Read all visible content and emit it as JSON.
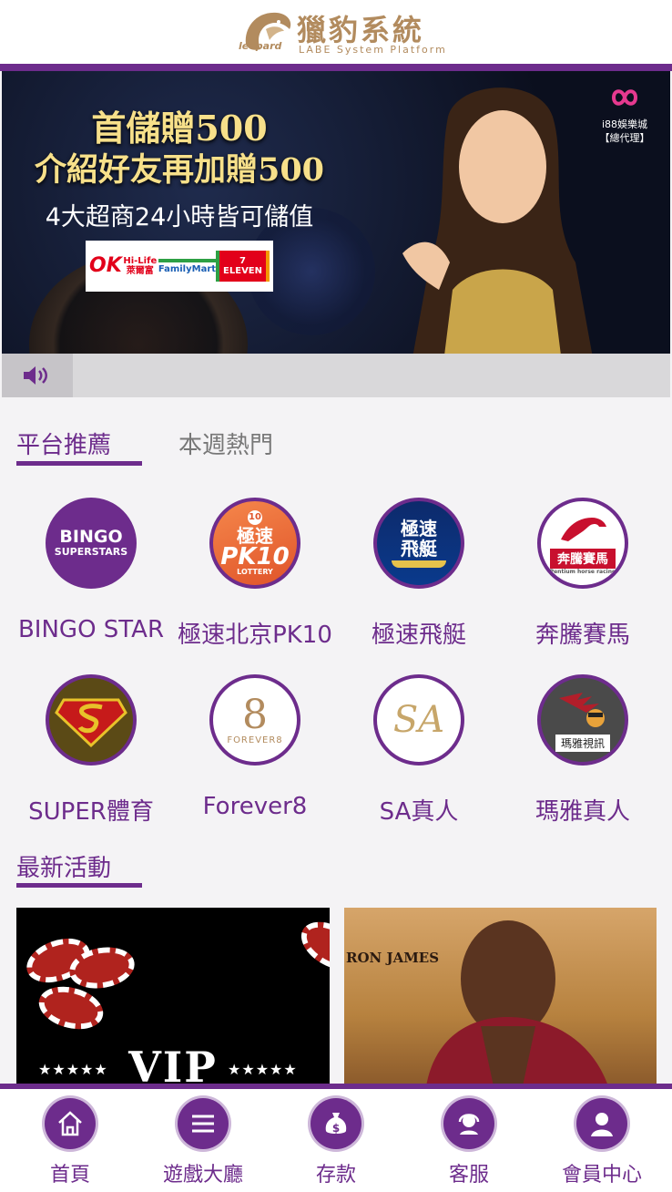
{
  "header": {
    "brand": "獵豹系統",
    "subtitle": "LABE System Platform",
    "logo_word": "leopard"
  },
  "banner": {
    "line1": "首儲贈500",
    "line2": "介紹好友再加贈500",
    "line3": "4大超商24小時皆可儲值",
    "stores": [
      "OK",
      "Hi-Life 萊爾富",
      "FamilyMart",
      "7 ELEVEN"
    ],
    "agent_line1": "i88娛樂城",
    "agent_line2": "【總代理】"
  },
  "marquee": {
    "icon": "speaker-icon"
  },
  "tabs": {
    "active": "平台推薦",
    "inactive": "本週熱門"
  },
  "games": [
    {
      "label": "BINGO STAR",
      "icon_text": [
        "BINGO",
        "SUPERSTARS"
      ]
    },
    {
      "label": "極速北京PK10",
      "icon_text": [
        "10",
        "極速",
        "PK10",
        "LOTTERY"
      ]
    },
    {
      "label": "極速飛艇",
      "icon_text": [
        "極速",
        "飛艇"
      ]
    },
    {
      "label": "奔騰賽馬",
      "icon_text": [
        "奔騰賽馬",
        "Pentium horse racing"
      ]
    },
    {
      "label": "SUPER體育",
      "icon_text": []
    },
    {
      "label": "Forever8",
      "icon_text": [
        "8",
        "FOREVER8"
      ]
    },
    {
      "label": "SA真人",
      "icon_text": [
        "SA"
      ]
    },
    {
      "label": "瑪雅真人",
      "icon_text": [
        "瑪雅視訊"
      ]
    }
  ],
  "news": {
    "title": "最新活動",
    "promo1": {
      "text": "VIP",
      "stars": "★★★★★"
    },
    "promo2": {
      "text": "RON JAMES"
    }
  },
  "bottom_nav": [
    {
      "label": "首頁",
      "icon": "home-icon"
    },
    {
      "label": "遊戲大廳",
      "icon": "menu-icon"
    },
    {
      "label": "存款",
      "icon": "money-bag-icon"
    },
    {
      "label": "客服",
      "icon": "support-icon"
    },
    {
      "label": "會員中心",
      "icon": "user-icon"
    }
  ],
  "colors": {
    "primary": "#6d2c8c",
    "gold": "#b28b5e",
    "background": "#f4f3f5"
  }
}
